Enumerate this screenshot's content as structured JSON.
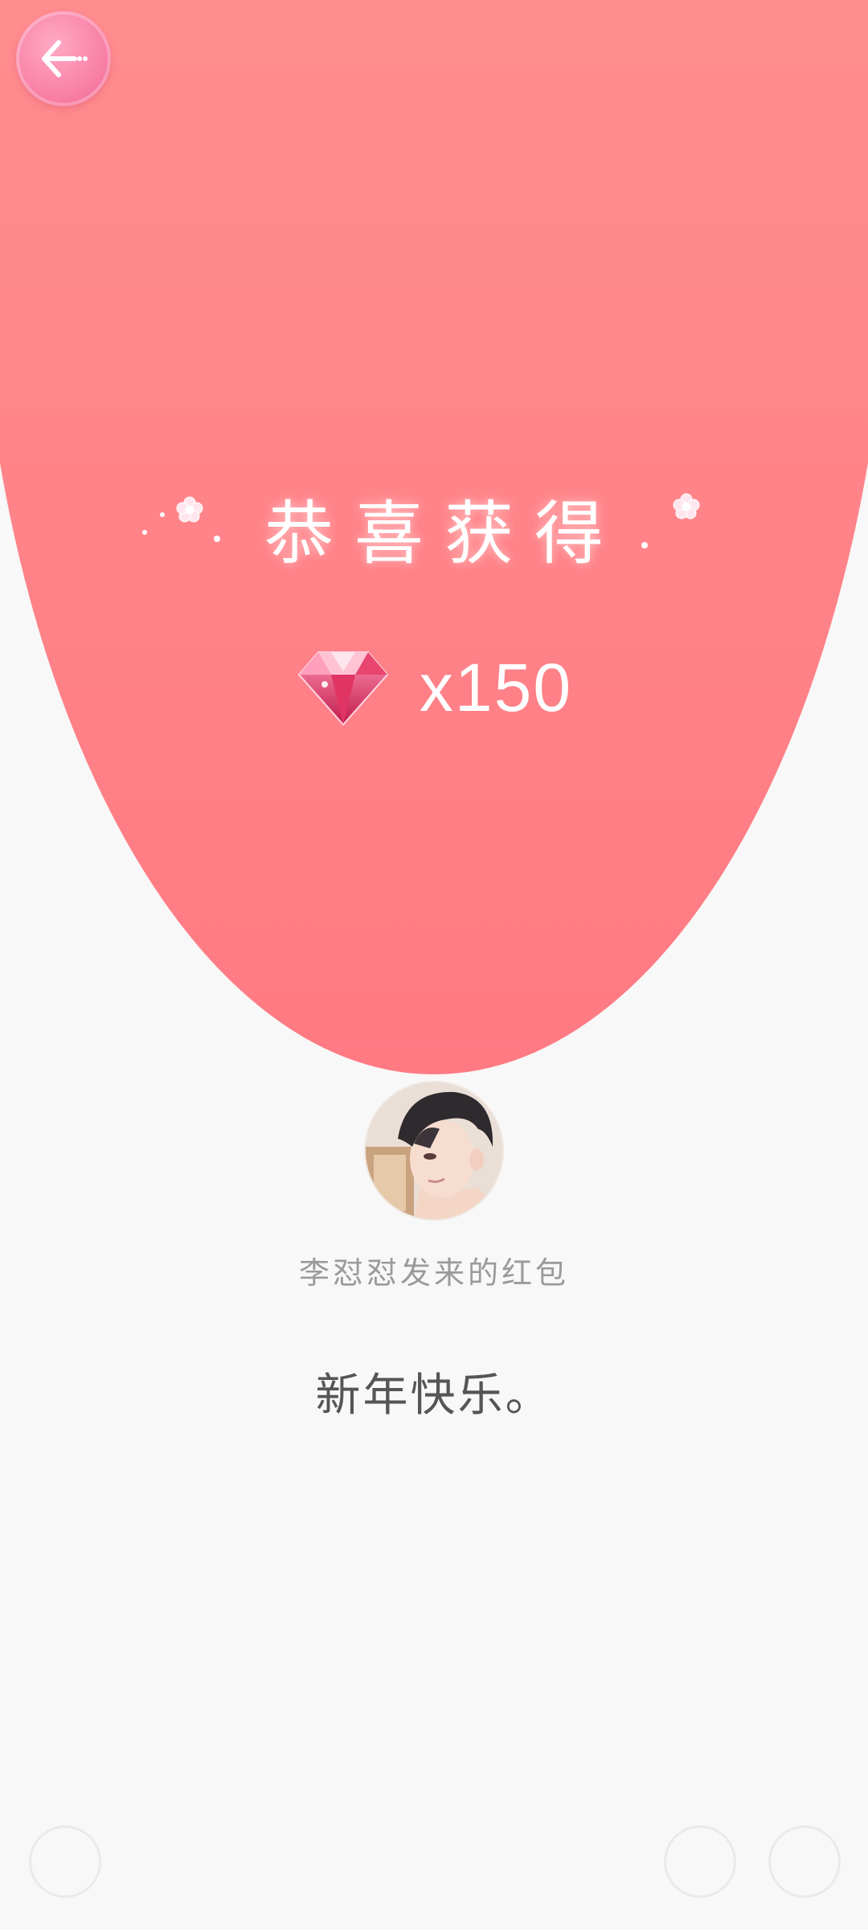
{
  "header": {
    "back_icon": "back-arrow-icon"
  },
  "reward": {
    "title": "恭喜获得",
    "item_icon": "diamond-gem-icon",
    "amount_text": "x150",
    "amount": 150
  },
  "sender": {
    "avatar": "male-character-avatar",
    "label": "李怼怼发来的红包"
  },
  "message": {
    "text": "新年快乐。"
  },
  "bottom_bar": {
    "icons": [
      "voice-icon",
      "emoji-icon",
      "plus-icon"
    ]
  },
  "colors": {
    "envelope_top": "#fe9b9a",
    "envelope_bottom": "#ff7a83",
    "back_button": "#f77aa2",
    "background": "#f8f8f8",
    "sender_label": "#9a9a9a",
    "message": "#555555"
  }
}
